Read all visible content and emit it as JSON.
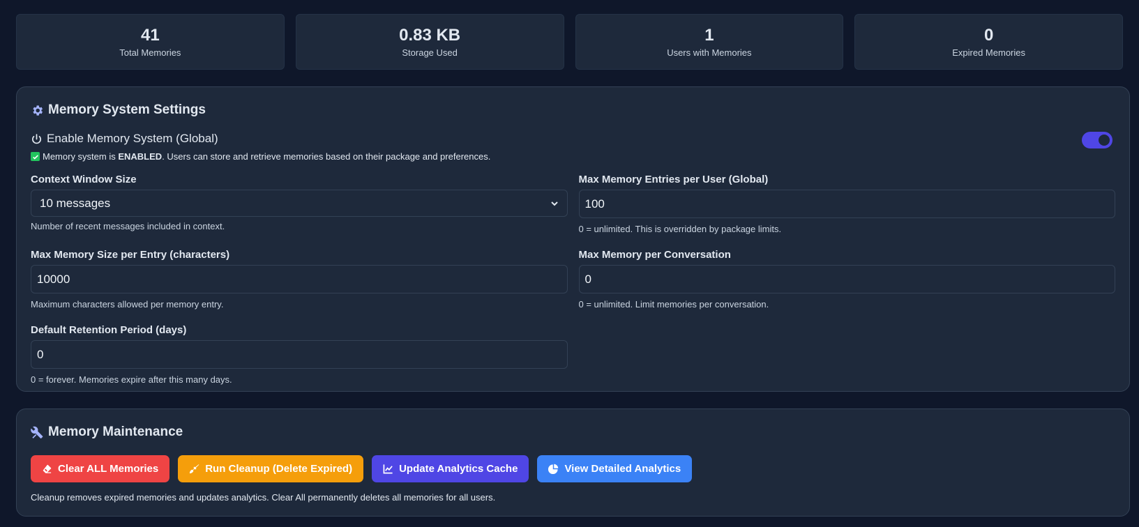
{
  "stats": [
    {
      "value": "41",
      "label": "Total Memories"
    },
    {
      "value": "0.83 KB",
      "label": "Storage Used"
    },
    {
      "value": "1",
      "label": "Users with Memories"
    },
    {
      "value": "0",
      "label": "Expired Memories"
    }
  ],
  "settings": {
    "title": "Memory System Settings",
    "icon": "gear-icon",
    "enable_label": "Enable Memory System (Global)",
    "enabled": true,
    "status_prefix": "Memory system is ",
    "status_strong": "ENABLED",
    "status_suffix": ". Users can store and retrieve memories based on their package and preferences.",
    "context_window": {
      "label": "Context Window Size",
      "value": "10 messages",
      "help": "Number of recent messages included in context."
    },
    "max_entries": {
      "label": "Max Memory Entries per User (Global)",
      "value": "100",
      "help": "0 = unlimited. This is overridden by package limits."
    },
    "max_size": {
      "label": "Max Memory Size per Entry (characters)",
      "value": "10000",
      "help": "Maximum characters allowed per memory entry."
    },
    "max_per_conversation": {
      "label": "Max Memory per Conversation",
      "value": "0",
      "help": "0 = unlimited. Limit memories per conversation."
    },
    "retention": {
      "label": "Default Retention Period (days)",
      "value": "0",
      "help": "0 = forever. Memories expire after this many days."
    }
  },
  "maintenance": {
    "title": "Memory Maintenance",
    "icon": "tools-icon",
    "buttons": {
      "clear_all": "Clear ALL Memories",
      "cleanup": "Run Cleanup (Delete Expired)",
      "update_cache": "Update Analytics Cache",
      "view_analytics": "View Detailed Analytics"
    },
    "help": "Cleanup removes expired memories and updates analytics. Clear All permanently deletes all memories for all users."
  },
  "colors": {
    "background": "#0f172a",
    "panel": "#1e293b",
    "accent": "#4f46e5",
    "danger": "#ef4444",
    "warning": "#f59e0b",
    "info": "#3b82f6",
    "success": "#22c55e"
  }
}
